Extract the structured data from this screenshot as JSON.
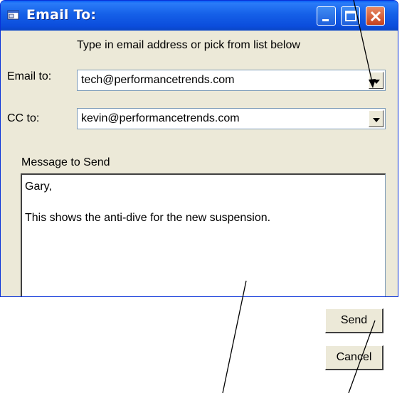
{
  "window": {
    "title": "Email To:",
    "icon": "mail-window-icon",
    "controls": [
      "minimize-icon",
      "maximize-icon",
      "close-icon"
    ]
  },
  "form": {
    "hint": "Type in email address or pick from list below",
    "email_label": "Email to:",
    "email_value": "tech@performancetrends.com",
    "cc_label": "CC to:",
    "cc_value": "kevin@performancetrends.com",
    "message_label": "Message to Send",
    "message_lines": [
      "Gary,",
      "This shows the anti-dive for the new suspension."
    ]
  },
  "buttons": {
    "send": "Send",
    "cancel": "Cancel"
  },
  "colors": {
    "titlebar": "#0b4ddc",
    "window_bg": "#ece9d8",
    "close_button": "#c6421e"
  }
}
